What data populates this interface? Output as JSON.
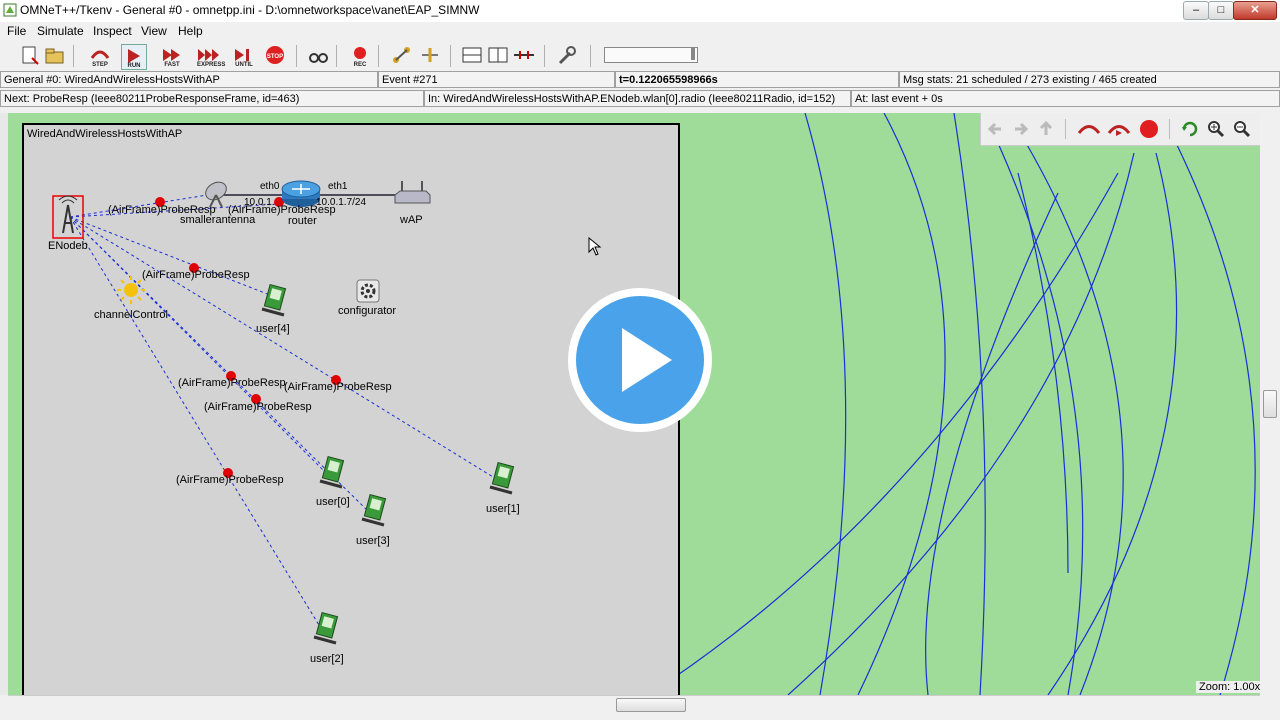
{
  "window": {
    "title": "OMNeT++/Tkenv - General #0 - omnetpp.ini - D:\\omnetworkspace\\vanet\\EAP_SIMNW",
    "minimize": "–",
    "maximize": "□",
    "close": "✕"
  },
  "menu": [
    "File",
    "Simulate",
    "Inspect",
    "View",
    "Help"
  ],
  "toolbar": {
    "step": "STEP",
    "run": "RUN",
    "fast": "FAST",
    "express": "EXPRESS",
    "until": "UNTIL",
    "stop": "STOP",
    "rec": "REC"
  },
  "status": {
    "run_name": "General #0: WiredAndWirelessHostsWithAP",
    "event": "Event #271",
    "time": "t=0.122065598966s",
    "msg_stats": "Msg stats: 21 scheduled / 273 existing / 465 created",
    "next": "Next: ProbeResp (Ieee80211ProbeResponseFrame, id=463)",
    "in": "In: WiredAndWirelessHostsWithAP.ENodeb.wlan[0].radio (Ieee80211Radio, id=152)",
    "at": "At: last event + 0s"
  },
  "network": {
    "title": "WiredAndWirelessHostsWithAP",
    "nodes": {
      "enodeb": "ENodeb",
      "antenna": "smallerantenna",
      "router": "router",
      "wap": "wAP",
      "channel": "channelControl",
      "configurator": "configurator",
      "user0": "user[0]",
      "user1": "user[1]",
      "user2": "user[2]",
      "user3": "user[3]",
      "user4": "user[4]"
    },
    "links": {
      "eth0": "eth0",
      "eth1": "eth1",
      "ip_left": "10.0.1.",
      "ip_right": "10.0.1.7/24"
    },
    "message": "(AirFrame)ProbeResp"
  },
  "zoom": "Zoom: 1.00x",
  "colors": {
    "range_green": "#9fdc9a",
    "network_bg": "#d3d3d3",
    "message_red": "#e00000",
    "link_blue": "#1a2fd6",
    "play_blue": "#4aa3ea"
  }
}
